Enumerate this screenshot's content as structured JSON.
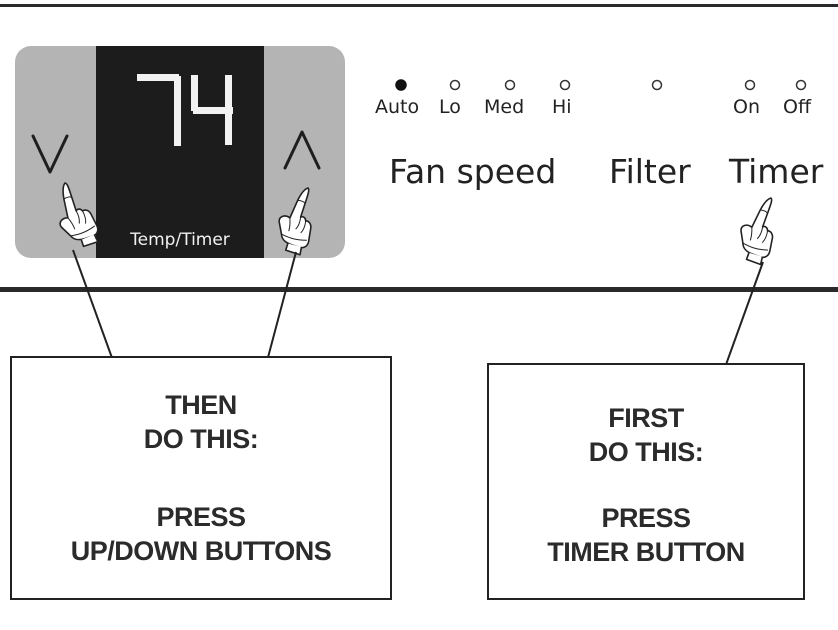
{
  "display": {
    "digits": "74",
    "label": "Temp/Timer"
  },
  "fan_speed": {
    "options": [
      {
        "label": "Auto",
        "selected": true
      },
      {
        "label": "Lo",
        "selected": false
      },
      {
        "label": "Med",
        "selected": false
      },
      {
        "label": "Hi",
        "selected": false
      }
    ],
    "label": "Fan speed"
  },
  "filter": {
    "label": "Filter"
  },
  "timer": {
    "options": [
      {
        "label": "On",
        "selected": false
      },
      {
        "label": "Off",
        "selected": false
      }
    ],
    "label": "Timer"
  },
  "step_then": {
    "line1": "THEN",
    "line2": "DO THIS:",
    "line3": "PRESS",
    "line4": "UP/DOWN BUTTONS"
  },
  "step_first": {
    "line1": "FIRST",
    "line2": "DO THIS:",
    "line3": "PRESS",
    "line4": "TIMER BUTTON"
  },
  "colors": {
    "panel": "#b4b4b4",
    "display_background": "#1c1c1c",
    "display_digits": "#f2f2f2",
    "ink": "#222222"
  },
  "icons": [
    "down-arrow-icon",
    "up-arrow-icon",
    "pointing-hand-icon"
  ]
}
